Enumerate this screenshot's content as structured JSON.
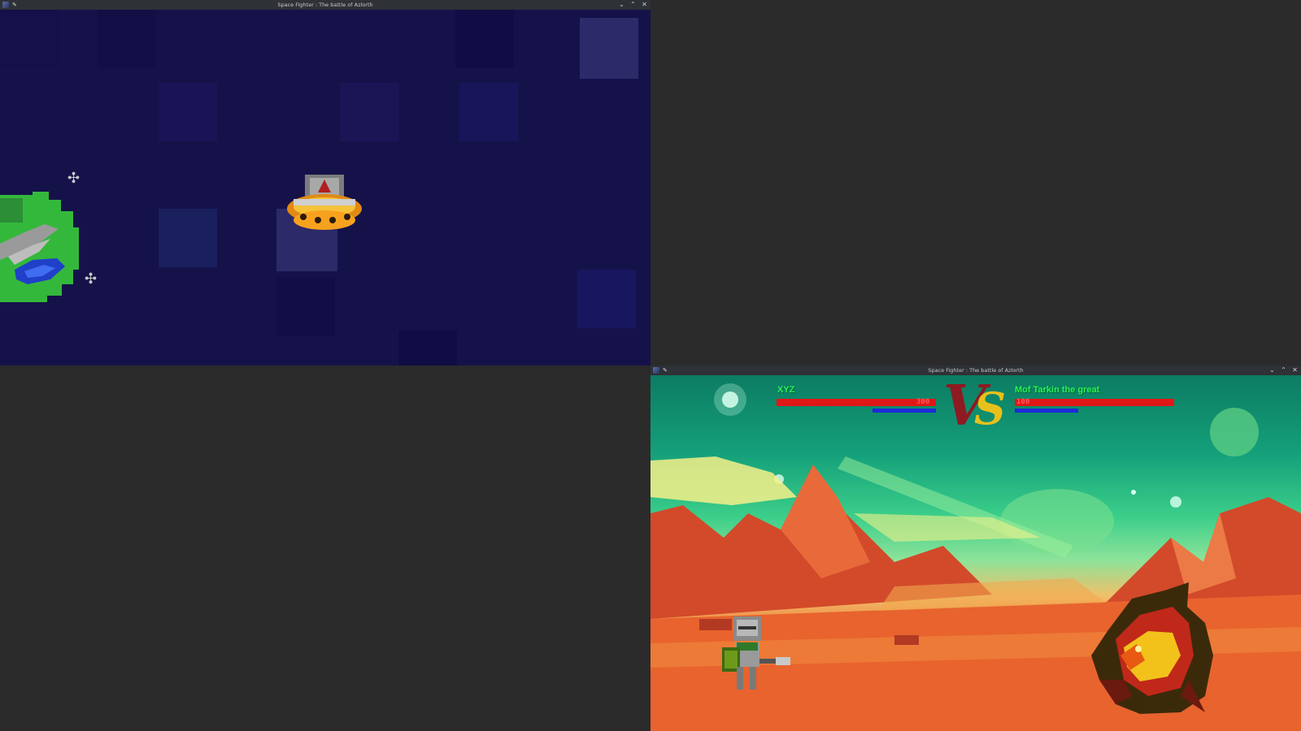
{
  "window_top": {
    "title": "Space Fighter : The battle of Azlorth"
  },
  "window_bottom": {
    "title": "Space Fighter : The battle of Azlorth",
    "player": {
      "name": "XYZ",
      "hp_value": "300",
      "hp_fraction": 1.0,
      "mp_fraction": 0.4
    },
    "enemy": {
      "name": "Mof Tarkin the great",
      "hp_value": "100",
      "hp_fraction": 1.0,
      "mp_fraction": 0.4
    },
    "vs_v": "V",
    "vs_s": "S"
  },
  "titlebar_buttons": {
    "minimize": "⌄",
    "maximize": "⌃",
    "close": "✕"
  },
  "colors": {
    "space_bg": "#15124a",
    "name_green": "#29f05a",
    "hp_red": "#e11717",
    "mp_blue": "#1b2bd8"
  }
}
